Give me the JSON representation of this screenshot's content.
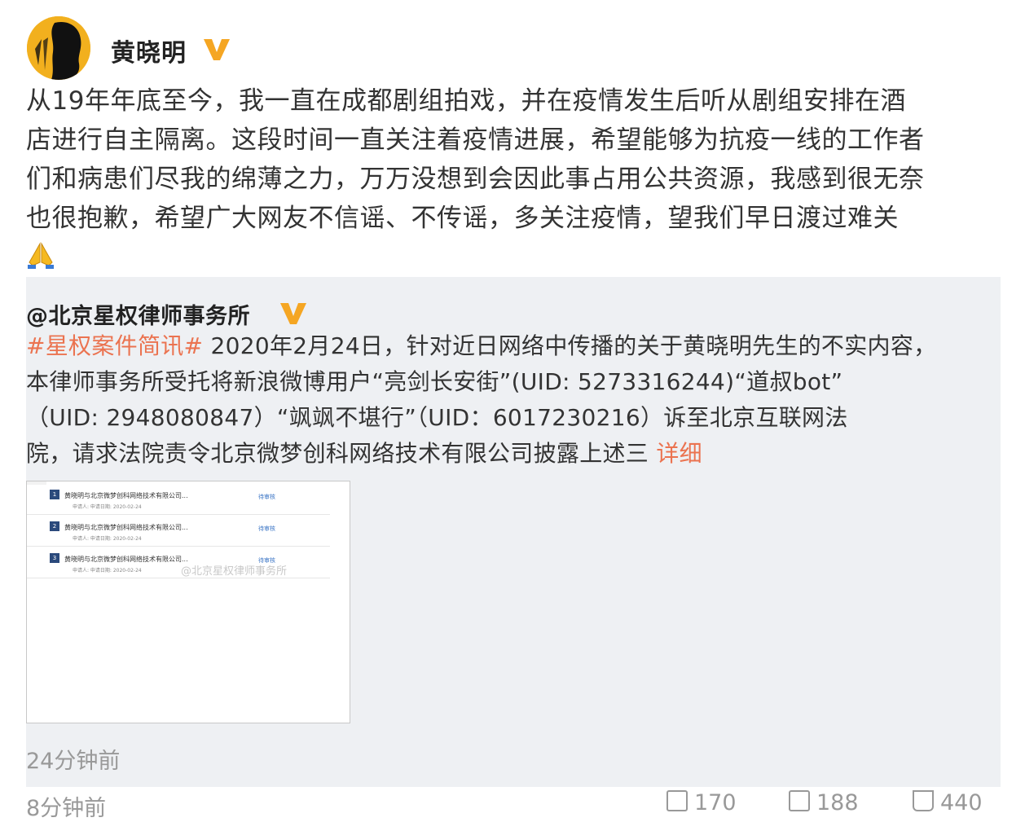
{
  "post": {
    "author": "黄晓明",
    "text_lines": [
      "从19年年底至今，我一直在成都剧组拍戏，并在疫情发生后听从剧组安排在酒",
      "店进行自主隔离。这段时间一直关注着疫情进展，希望能够为抗疫一线的工作者",
      "们和病患们尽我的绵薄之力，万万没想到会因此事占用公共资源，我感到很无奈",
      "也很抱歉，希望广大网友不信谣、不传谣，多关注疫情，望我们早日渡过难关"
    ],
    "emoji": "folded-hands-icon"
  },
  "repost": {
    "author": "@北京星权律师事务所",
    "hashtag": "#星权案件简讯#",
    "line1_rest": " 2020年2月24日，针对近日网络中传播的关于黄晓明先生的不实内容，",
    "line2": "本律师事务所受托将新浪微博用户“亮剑长安街”(UID: 5273316244)“道叔bot”",
    "line3": "（UID: 2948080847）“飒飒不堪行”（UID：6017230216）诉至北京互联网法",
    "line4": "院，请求法院责令北京微梦创科网络技术有限公司披露上述三",
    "more_label": "详细",
    "time": "24分钟前",
    "thumbnail": {
      "rows": [
        {
          "num": "1",
          "title": "黄晓明与北京微梦创科网络技术有限公司...",
          "meta": "申请人:        申请日期: 2020-02-24",
          "status": "待审核"
        },
        {
          "num": "2",
          "title": "黄晓明与北京微梦创科网络技术有限公司...",
          "meta": "申请人:        申请日期: 2020-02-24",
          "status": "待审核"
        },
        {
          "num": "3",
          "title": "黄晓明与北京微梦创科网络技术有限公司...",
          "meta": "申请人:        申请日期: 2020-02-24",
          "status": "待审核"
        }
      ],
      "watermark": "@北京星权律师事务所"
    }
  },
  "footer": {
    "time": "8分钟前",
    "reposts": "170",
    "comments": "188",
    "likes": "440"
  },
  "colors": {
    "accent": "#eb7350",
    "verified": "#f5a623",
    "repost_bg": "#eef0f3"
  }
}
